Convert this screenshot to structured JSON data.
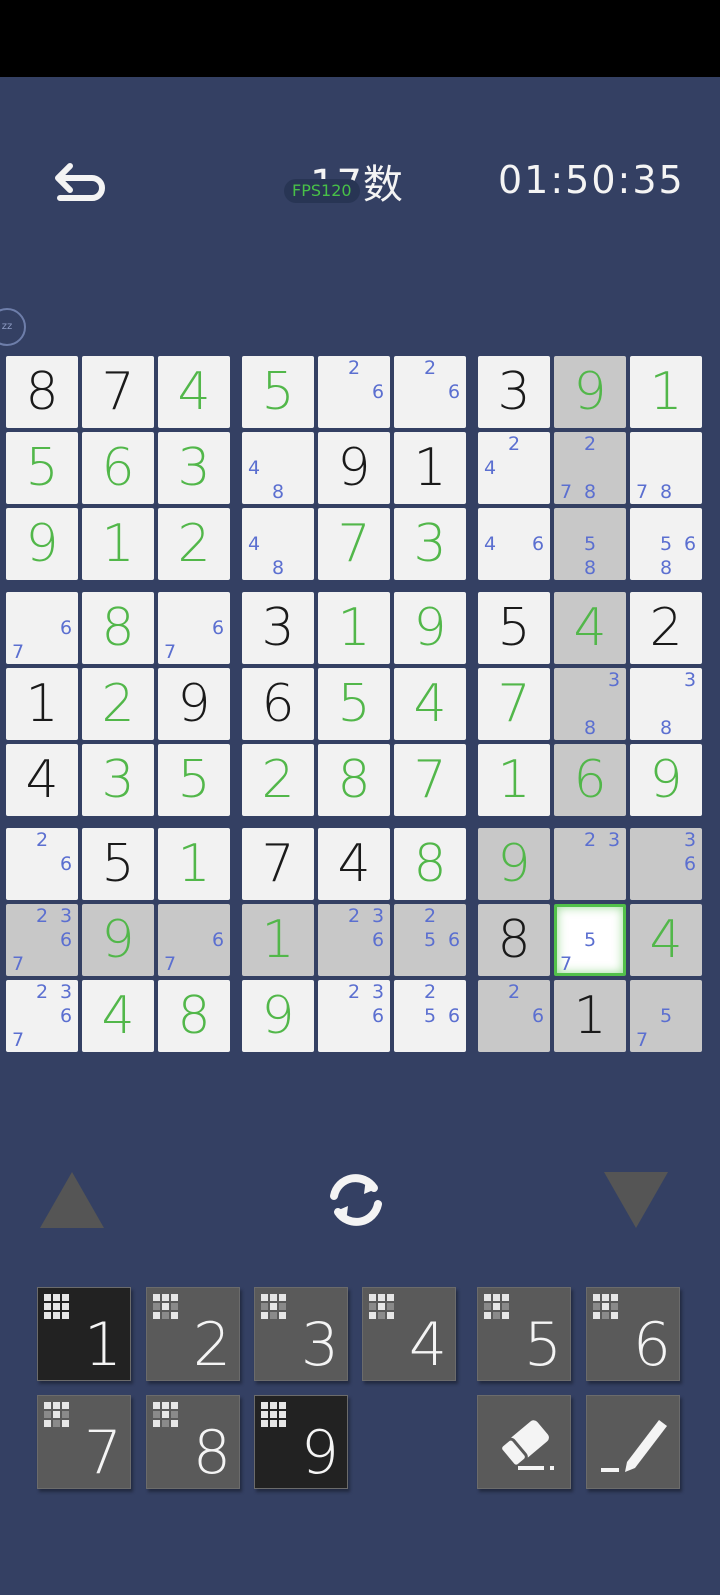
{
  "header": {
    "title": "17数",
    "fps_label": "FPS120",
    "timer": "01:50:35"
  },
  "colors": {
    "background": "#344063",
    "given_digit": "#1a1a1a",
    "user_digit": "#52b74a",
    "note_digit": "#5b6fd0",
    "selection": "#52c04a",
    "key": "#5a5a5a",
    "key_completed": "#222222"
  },
  "board": {
    "rows": [
      [
        {
          "v": "8",
          "t": "given"
        },
        {
          "v": "7",
          "t": "given"
        },
        {
          "v": "4",
          "t": "user"
        },
        {
          "v": "5",
          "t": "user"
        },
        {
          "notes": [
            2,
            6
          ]
        },
        {
          "notes": [
            2,
            6
          ]
        },
        {
          "v": "3",
          "t": "given"
        },
        {
          "v": "9",
          "t": "user",
          "shade": true
        },
        {
          "v": "1",
          "t": "user"
        }
      ],
      [
        {
          "v": "5",
          "t": "user"
        },
        {
          "v": "6",
          "t": "user"
        },
        {
          "v": "3",
          "t": "user"
        },
        {
          "notes": [
            4,
            8
          ]
        },
        {
          "v": "9",
          "t": "given"
        },
        {
          "v": "1",
          "t": "given"
        },
        {
          "notes": [
            2,
            4
          ]
        },
        {
          "notes": [
            2,
            7,
            8
          ],
          "shade": true
        },
        {
          "notes": [
            7,
            8
          ]
        }
      ],
      [
        {
          "v": "9",
          "t": "user"
        },
        {
          "v": "1",
          "t": "user"
        },
        {
          "v": "2",
          "t": "user"
        },
        {
          "notes": [
            4,
            8
          ]
        },
        {
          "v": "7",
          "t": "user"
        },
        {
          "v": "3",
          "t": "user"
        },
        {
          "notes": [
            4,
            6
          ]
        },
        {
          "notes": [
            5,
            8
          ],
          "shade": true
        },
        {
          "notes": [
            5,
            6,
            8
          ]
        }
      ],
      [
        {
          "notes": [
            6,
            7
          ]
        },
        {
          "v": "8",
          "t": "user"
        },
        {
          "notes": [
            6,
            7
          ]
        },
        {
          "v": "3",
          "t": "given"
        },
        {
          "v": "1",
          "t": "user"
        },
        {
          "v": "9",
          "t": "user"
        },
        {
          "v": "5",
          "t": "given"
        },
        {
          "v": "4",
          "t": "user",
          "shade": true
        },
        {
          "v": "2",
          "t": "given"
        }
      ],
      [
        {
          "v": "1",
          "t": "given"
        },
        {
          "v": "2",
          "t": "user"
        },
        {
          "v": "9",
          "t": "given"
        },
        {
          "v": "6",
          "t": "given"
        },
        {
          "v": "5",
          "t": "user"
        },
        {
          "v": "4",
          "t": "user"
        },
        {
          "v": "7",
          "t": "user"
        },
        {
          "notes": [
            3,
            8
          ],
          "shade": true
        },
        {
          "notes": [
            3,
            8
          ]
        }
      ],
      [
        {
          "v": "4",
          "t": "given"
        },
        {
          "v": "3",
          "t": "user"
        },
        {
          "v": "5",
          "t": "user"
        },
        {
          "v": "2",
          "t": "user"
        },
        {
          "v": "8",
          "t": "user"
        },
        {
          "v": "7",
          "t": "user"
        },
        {
          "v": "1",
          "t": "user"
        },
        {
          "v": "6",
          "t": "user",
          "shade": true
        },
        {
          "v": "9",
          "t": "user"
        }
      ],
      [
        {
          "notes": [
            2,
            6
          ]
        },
        {
          "v": "5",
          "t": "given"
        },
        {
          "v": "1",
          "t": "user"
        },
        {
          "v": "7",
          "t": "given"
        },
        {
          "v": "4",
          "t": "given"
        },
        {
          "v": "8",
          "t": "user"
        },
        {
          "v": "9",
          "t": "user",
          "shade": true
        },
        {
          "notes": [
            2,
            3
          ],
          "shade": true
        },
        {
          "notes": [
            3,
            6
          ],
          "shade": true
        }
      ],
      [
        {
          "notes": [
            2,
            3,
            6,
            7
          ],
          "shade": true
        },
        {
          "v": "9",
          "t": "user",
          "shade": true
        },
        {
          "notes": [
            6,
            7
          ],
          "shade": true
        },
        {
          "v": "1",
          "t": "user",
          "shade": true
        },
        {
          "notes": [
            2,
            3,
            6
          ],
          "shade": true
        },
        {
          "notes": [
            2,
            5,
            6
          ],
          "shade": true
        },
        {
          "v": "8",
          "t": "given",
          "shade": true
        },
        {
          "notes": [
            5,
            7
          ],
          "selected": true
        },
        {
          "v": "4",
          "t": "user",
          "shade": true
        }
      ],
      [
        {
          "notes": [
            2,
            3,
            6,
            7
          ]
        },
        {
          "v": "4",
          "t": "user"
        },
        {
          "v": "8",
          "t": "user"
        },
        {
          "v": "9",
          "t": "user"
        },
        {
          "notes": [
            2,
            3,
            6
          ]
        },
        {
          "notes": [
            2,
            5,
            6
          ]
        },
        {
          "notes": [
            2,
            6
          ],
          "shade": true
        },
        {
          "v": "1",
          "t": "given",
          "shade": true
        },
        {
          "notes": [
            5,
            7
          ],
          "shade": true
        }
      ]
    ]
  },
  "keypad": {
    "keys": [
      {
        "label": "1",
        "completed": true
      },
      {
        "label": "2",
        "completed": false
      },
      {
        "label": "3",
        "completed": false
      },
      {
        "label": "4",
        "completed": false
      },
      {
        "label": "5",
        "completed": false
      },
      {
        "label": "6",
        "completed": false
      },
      {
        "label": "7",
        "completed": false
      },
      {
        "label": "8",
        "completed": false
      },
      {
        "label": "9",
        "completed": true
      }
    ],
    "tools": [
      "eraser-icon",
      "pencil-icon"
    ]
  }
}
